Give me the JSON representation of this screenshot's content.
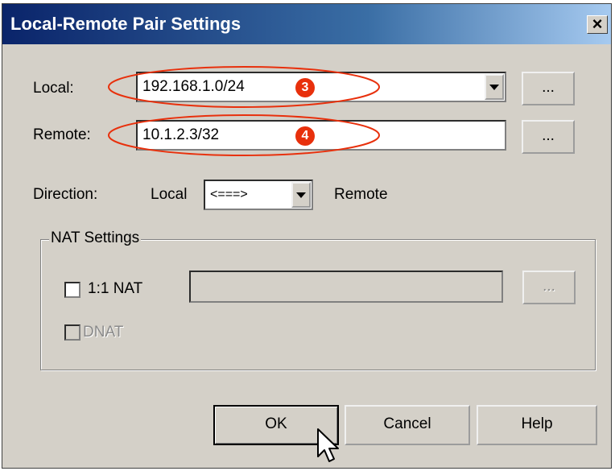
{
  "dialog": {
    "title": "Local-Remote Pair Settings",
    "close_label": "×"
  },
  "local": {
    "label": "Local:",
    "value": "192.168.1.0/24",
    "badge": "3",
    "browse_label": "..."
  },
  "remote": {
    "label": "Remote:",
    "value": "10.1.2.3/32",
    "badge": "4",
    "browse_label": "..."
  },
  "direction": {
    "label": "Direction:",
    "left_label": "Local",
    "value": "<===>",
    "right_label": "Remote"
  },
  "nat": {
    "group_label": "NAT Settings",
    "one_to_one_label": "1:1 NAT",
    "one_to_one_checked": false,
    "one_to_one_value": "",
    "browse_label": "...",
    "dnat_label": "DNAT",
    "dnat_checked": false
  },
  "buttons": {
    "ok": "OK",
    "cancel": "Cancel",
    "help": "Help"
  },
  "colors": {
    "annotation": "#e8300c",
    "title_bar": "#0a246a"
  }
}
